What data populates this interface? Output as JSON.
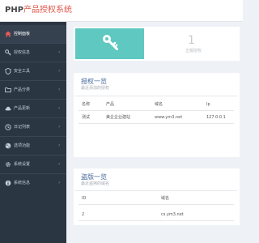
{
  "header": {
    "logo_prefix": "PHP",
    "logo_suffix": "产品授权系统"
  },
  "sidebar": {
    "items": [
      {
        "label": "控制面板",
        "icon": "home-icon",
        "active": true,
        "has_arrow": false
      },
      {
        "label": "授权信息",
        "icon": "key-icon",
        "active": false,
        "has_arrow": true
      },
      {
        "label": "安全工具",
        "icon": "shield-icon",
        "active": false,
        "has_arrow": true
      },
      {
        "label": "产品分类",
        "icon": "folder-icon",
        "active": false,
        "has_arrow": true
      },
      {
        "label": "产品更新",
        "icon": "cloud-icon",
        "active": false,
        "has_arrow": true
      },
      {
        "label": "日记列表",
        "icon": "clock-icon",
        "active": false,
        "has_arrow": true
      },
      {
        "label": "选项功能",
        "icon": "globe-icon",
        "active": false,
        "has_arrow": true
      },
      {
        "label": "系统设置",
        "icon": "gear-icon",
        "active": false,
        "has_arrow": true
      },
      {
        "label": "系统信息",
        "icon": "info-icon",
        "active": false,
        "has_arrow": true
      }
    ]
  },
  "stats": {
    "count": "1",
    "label": "正版授权"
  },
  "auth_list": {
    "title": "授权一览",
    "subtitle": "最近添加的授权",
    "headers": [
      "名称",
      "产品",
      "域名",
      "Ip"
    ],
    "rows": [
      [
        "测试",
        "美企企业建站",
        "www.ym3.net",
        "127.0.0.1"
      ]
    ]
  },
  "pirate_list": {
    "title": "盗版一览",
    "subtitle": "最近盗用的域名",
    "headers": [
      "ID",
      "域名"
    ],
    "rows": [
      [
        "2",
        "cs.ym3.net"
      ]
    ]
  },
  "colors": {
    "sidebar": "#2b3643",
    "tile": "#5ec8c1",
    "title": "#44679b",
    "logo_accent": "#e1574b"
  }
}
